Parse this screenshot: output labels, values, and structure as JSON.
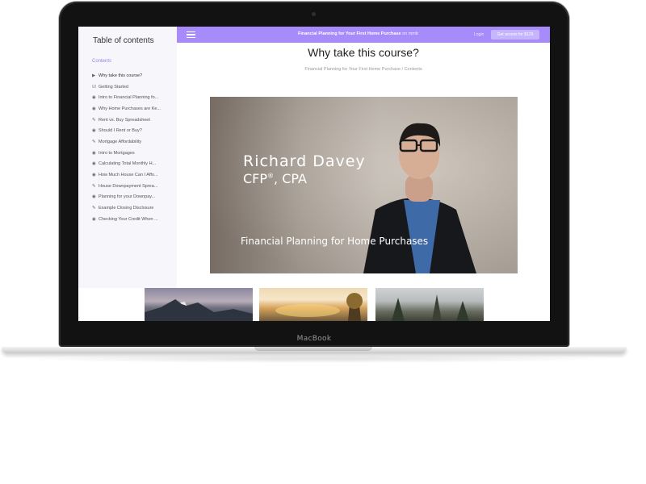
{
  "device": {
    "brand_label": "MacBook"
  },
  "sidebar": {
    "title": "Table of contents",
    "section": "Contents",
    "items": [
      {
        "icon": "video-icon",
        "glyph": "▶",
        "label": "Why take this course?",
        "active": true
      },
      {
        "icon": "checklist-icon",
        "glyph": "☑",
        "label": "Getting Started"
      },
      {
        "icon": "video-icon",
        "glyph": "◉",
        "label": "Intro to Financial Planning fo..."
      },
      {
        "icon": "video-icon",
        "glyph": "◉",
        "label": "Why Home Purchases are Ke..."
      },
      {
        "icon": "document-icon",
        "glyph": "✎",
        "label": "Rent vs. Buy Spreadsheet"
      },
      {
        "icon": "video-icon",
        "glyph": "◉",
        "label": "Should I Rent or Buy?"
      },
      {
        "icon": "document-icon",
        "glyph": "✎",
        "label": "Mortgage Affordability"
      },
      {
        "icon": "video-icon",
        "glyph": "◉",
        "label": "Intro to Mortgages"
      },
      {
        "icon": "video-icon",
        "glyph": "◉",
        "label": "Calculating Total Monthly H..."
      },
      {
        "icon": "video-icon",
        "glyph": "◉",
        "label": "How Much House Can I Affo..."
      },
      {
        "icon": "document-icon",
        "glyph": "✎",
        "label": "House Downpayment Sprea..."
      },
      {
        "icon": "video-icon",
        "glyph": "◉",
        "label": "Planning for your Downpay..."
      },
      {
        "icon": "document-icon",
        "glyph": "✎",
        "label": "Example Closing Disclosure"
      },
      {
        "icon": "video-icon",
        "glyph": "◉",
        "label": "Checking Your Credit When ..."
      }
    ]
  },
  "topbar": {
    "course_name": "Financial Planning for Your First Home Purchase",
    "brand": "on mmb",
    "login_label": "Login",
    "cta_label": "Get access for $129"
  },
  "main": {
    "title": "Why take this course?",
    "breadcrumb": "Financial Planning for Your First Home Purchase  /  Contents",
    "video": {
      "presenter_name": "Richard Davey",
      "presenter_credentials": "CFP",
      "registered_mark": "®",
      "credentials_suffix": ", CPA",
      "caption": "Financial Planning for Home Purchases"
    }
  },
  "colors": {
    "accent": "#a78bfa",
    "sidebar_bg": "#f6f6fb"
  }
}
